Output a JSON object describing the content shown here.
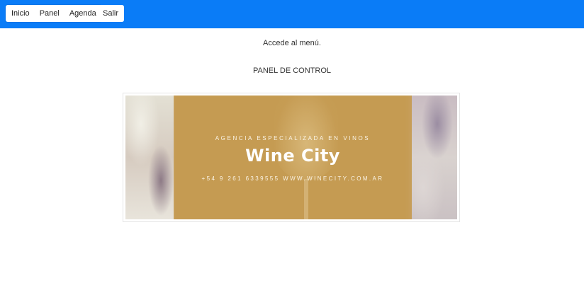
{
  "nav": {
    "items": [
      {
        "label": "Inicio"
      },
      {
        "label": "Panel"
      },
      {
        "label": "Agenda"
      }
    ],
    "logout_label": "Salir",
    "bar_color": "#0a7cf7"
  },
  "main": {
    "menu_text": "Accede al menú.",
    "panel_title": "PANEL DE CONTROL"
  },
  "banner": {
    "tagline": "AGENCIA ESPECIALIZADA EN VINOS",
    "brand": "Wine City",
    "contact": "+54 9 261 6339555 WWW.WINECITY.COM.AR",
    "accent_color": "#c59b52"
  }
}
